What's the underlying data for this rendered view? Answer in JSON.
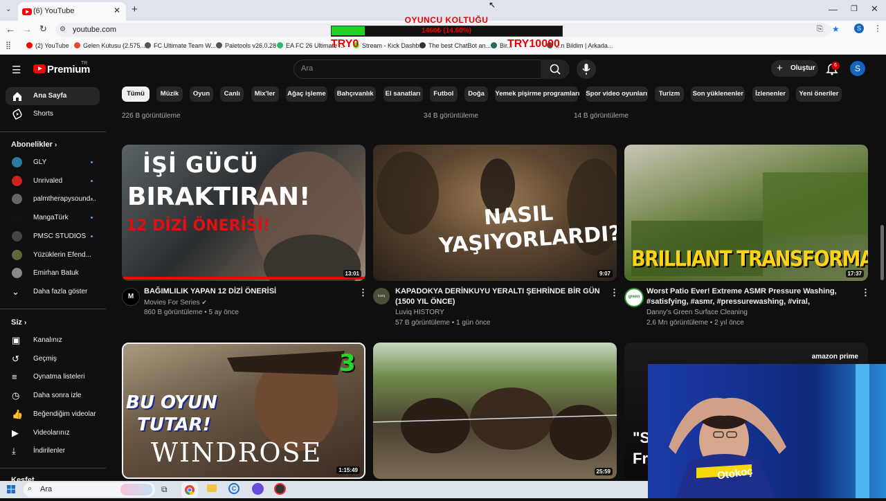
{
  "browser": {
    "tab_title": "(6) YouTube",
    "url": "youtube.com",
    "bookmarks": [
      {
        "label": "(2) YouTube",
        "color": "#ff0000"
      },
      {
        "label": "Gelen Kutusu (2.575...",
        "color": "#ea4335"
      },
      {
        "label": "FC Ultimate Team W...",
        "color": "#555555"
      },
      {
        "label": "Paletools v26.0.28",
        "color": "#555555"
      },
      {
        "label": "EA FC 26 Ultimate ...",
        "color": "#2eb872"
      },
      {
        "label": "Stream - Kick Dashb...",
        "color": "#53fc18"
      },
      {
        "label": "The best ChatBot an...",
        "color": "#333333"
      },
      {
        "label": "Bir...",
        "color": "#1a6b5a"
      },
      {
        "label": "...n Bildim | Arkada...",
        "color": "#555555"
      }
    ]
  },
  "overlay": {
    "title": "OYUNCU KOLTUĞU",
    "progress_text": "1460₺ (14.60%)",
    "progress_fraction": 0.146,
    "left_label": "TRY0",
    "right_label": "TRY10000",
    "fill_color": "#21d321",
    "text_color": "#e00000"
  },
  "youtube": {
    "logo": "Premium",
    "logo_region": "TR",
    "search_placeholder": "Ara",
    "create_label": "Oluştur",
    "notification_count": "6",
    "avatar_letter": "S",
    "chips": [
      "Tümü",
      "Müzik",
      "Oyun",
      "Canlı",
      "Mix'ler",
      "Ağaç işleme",
      "Bahçıvanlık",
      "El sanatları",
      "Futbol",
      "Doğa",
      "Yemek pişirme programları",
      "Spor video oyunları",
      "Turizm",
      "Son yüklenenler",
      "İzlenenler",
      "Yeni öneriler"
    ],
    "sidebar": {
      "home": "Ana Sayfa",
      "shorts": "Shorts",
      "subscriptions_header": "Abonelikler",
      "subscriptions": [
        "GLY",
        "Unrivaled",
        "palmtherapysound...",
        "MangaTürk",
        "PMSC STUDIOS",
        "Yüzüklerin Efend...",
        "Emirhan Batuk"
      ],
      "show_more": "Daha fazla göster",
      "you_header": "Siz",
      "you_items": [
        "Kanalınız",
        "Geçmiş",
        "Oynatma listeleri",
        "Daha sonra izle",
        "Beğendiğim videolar",
        "Videolarınız",
        "İndirilenler"
      ],
      "cut_header": "Keşfet"
    },
    "top_views": [
      "226 B görüntüleme",
      "34 B görüntüleme",
      "14 B görüntüleme"
    ],
    "videos": [
      {
        "thumb_text": [
          "İŞİ GÜCÜ",
          "BIRAKTIRAN!",
          "12 DİZİ ÖNERİSİ!"
        ],
        "duration": "13:01",
        "title": "BAĞIMLILIK YAPAN 12 DİZİ ÖNERİSİ",
        "channel": "Movies For Series",
        "meta": "860 B görüntüleme • 5 ay önce",
        "channel_avatar": "M"
      },
      {
        "thumb_text": [
          "NASIL",
          "YAŞIYORLARDI?"
        ],
        "duration": "9:07",
        "title": "KAPADOKYA DERİNKUYU YERALTI ŞEHRİNDE BİR GÜN (1500 YIL ÖNCE)",
        "channel": "Luviq HISTORY",
        "meta": "57 B görüntüleme • 1 gün önce",
        "channel_avatar": "luviq"
      },
      {
        "thumb_text": [
          "BRILLIANT TRANSFORMATION!"
        ],
        "duration": "17:37",
        "title": "Worst Patio Ever! Extreme ASMR Pressure Washing, #satisfying, #asmr, #pressurewashing, #viral,",
        "channel": "Danny's Green Surface Cleaning",
        "meta": "2,6 Mn görüntüleme • 2 yıl önce",
        "channel_avatar": "green"
      },
      {
        "thumb_text": [
          "BU OYUN",
          "TUTAR!",
          "WINDROSE",
          "3"
        ],
        "duration": "1:15:49"
      },
      {
        "thumb_text": [],
        "duration": "25:59"
      },
      {
        "thumb_text": [
          "amazon prime",
          "\"S",
          "Fr"
        ],
        "duration": ""
      }
    ]
  },
  "taskbar": {
    "search": "Ara"
  },
  "webcam": {
    "shirt_text": "Otokoç"
  }
}
